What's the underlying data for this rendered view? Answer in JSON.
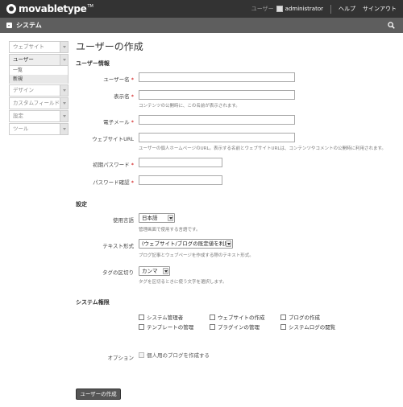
{
  "app": {
    "logo_text": "movabletype",
    "logo_tm": "TM"
  },
  "topnav": {
    "user_caption": "ユーザー",
    "username": "administrator",
    "help": "ヘルプ",
    "signout": "サインアウト"
  },
  "scope": {
    "title": "システム"
  },
  "sidebar": {
    "items": [
      {
        "label": "ウェブサイト"
      },
      {
        "label": "ユーザー"
      },
      {
        "label": "デザイン"
      },
      {
        "label": "カスタムフィールド"
      },
      {
        "label": "設定"
      },
      {
        "label": "ツール"
      }
    ],
    "user_subitems": [
      {
        "label": "一覧"
      },
      {
        "label": "新規"
      }
    ]
  },
  "page": {
    "title": "ユーザーの作成"
  },
  "user_info": {
    "section_title": "ユーザー情報",
    "username_label": "ユーザー名",
    "display_name_label": "表示名",
    "display_name_hint": "コンテンツの公開時に、この名前が表示されます。",
    "email_label": "電子メール",
    "url_label": "ウェブサイトURL",
    "url_hint": "ユーザーの個人ホームページのURL。表示する名前とウェブサイトURLは、コンテンツやコメントの公開時に利用されます。",
    "password_label": "初期パスワード",
    "password_confirm_label": "パスワード確認",
    "required_mark": "*"
  },
  "settings": {
    "section_title": "設定",
    "language_label": "使用言語",
    "language_value": "日本語",
    "language_hint": "管理画面で使用する言語です。",
    "text_format_label": "テキスト形式",
    "text_format_value": "(ウェブサイト/ブログの既定値を利用)",
    "text_format_hint": "ブログ記事とウェブページを作成する際のテキスト形式。",
    "tag_delim_label": "タグの区切り",
    "tag_delim_value": "カンマ",
    "tag_delim_hint": "タグを区切るときに使う文字を選択します。"
  },
  "permissions": {
    "section_title": "システム権限",
    "items": [
      {
        "label": "システム管理者"
      },
      {
        "label": "ウェブサイトの作成"
      },
      {
        "label": "ブログの作成"
      },
      {
        "label": "テンプレートの管理"
      },
      {
        "label": "プラグインの管理"
      },
      {
        "label": "システムログの閲覧"
      }
    ],
    "options_label": "オプション",
    "personal_blog_label": "個人用のブログを作成する"
  },
  "actions": {
    "submit": "ユーザーの作成"
  }
}
